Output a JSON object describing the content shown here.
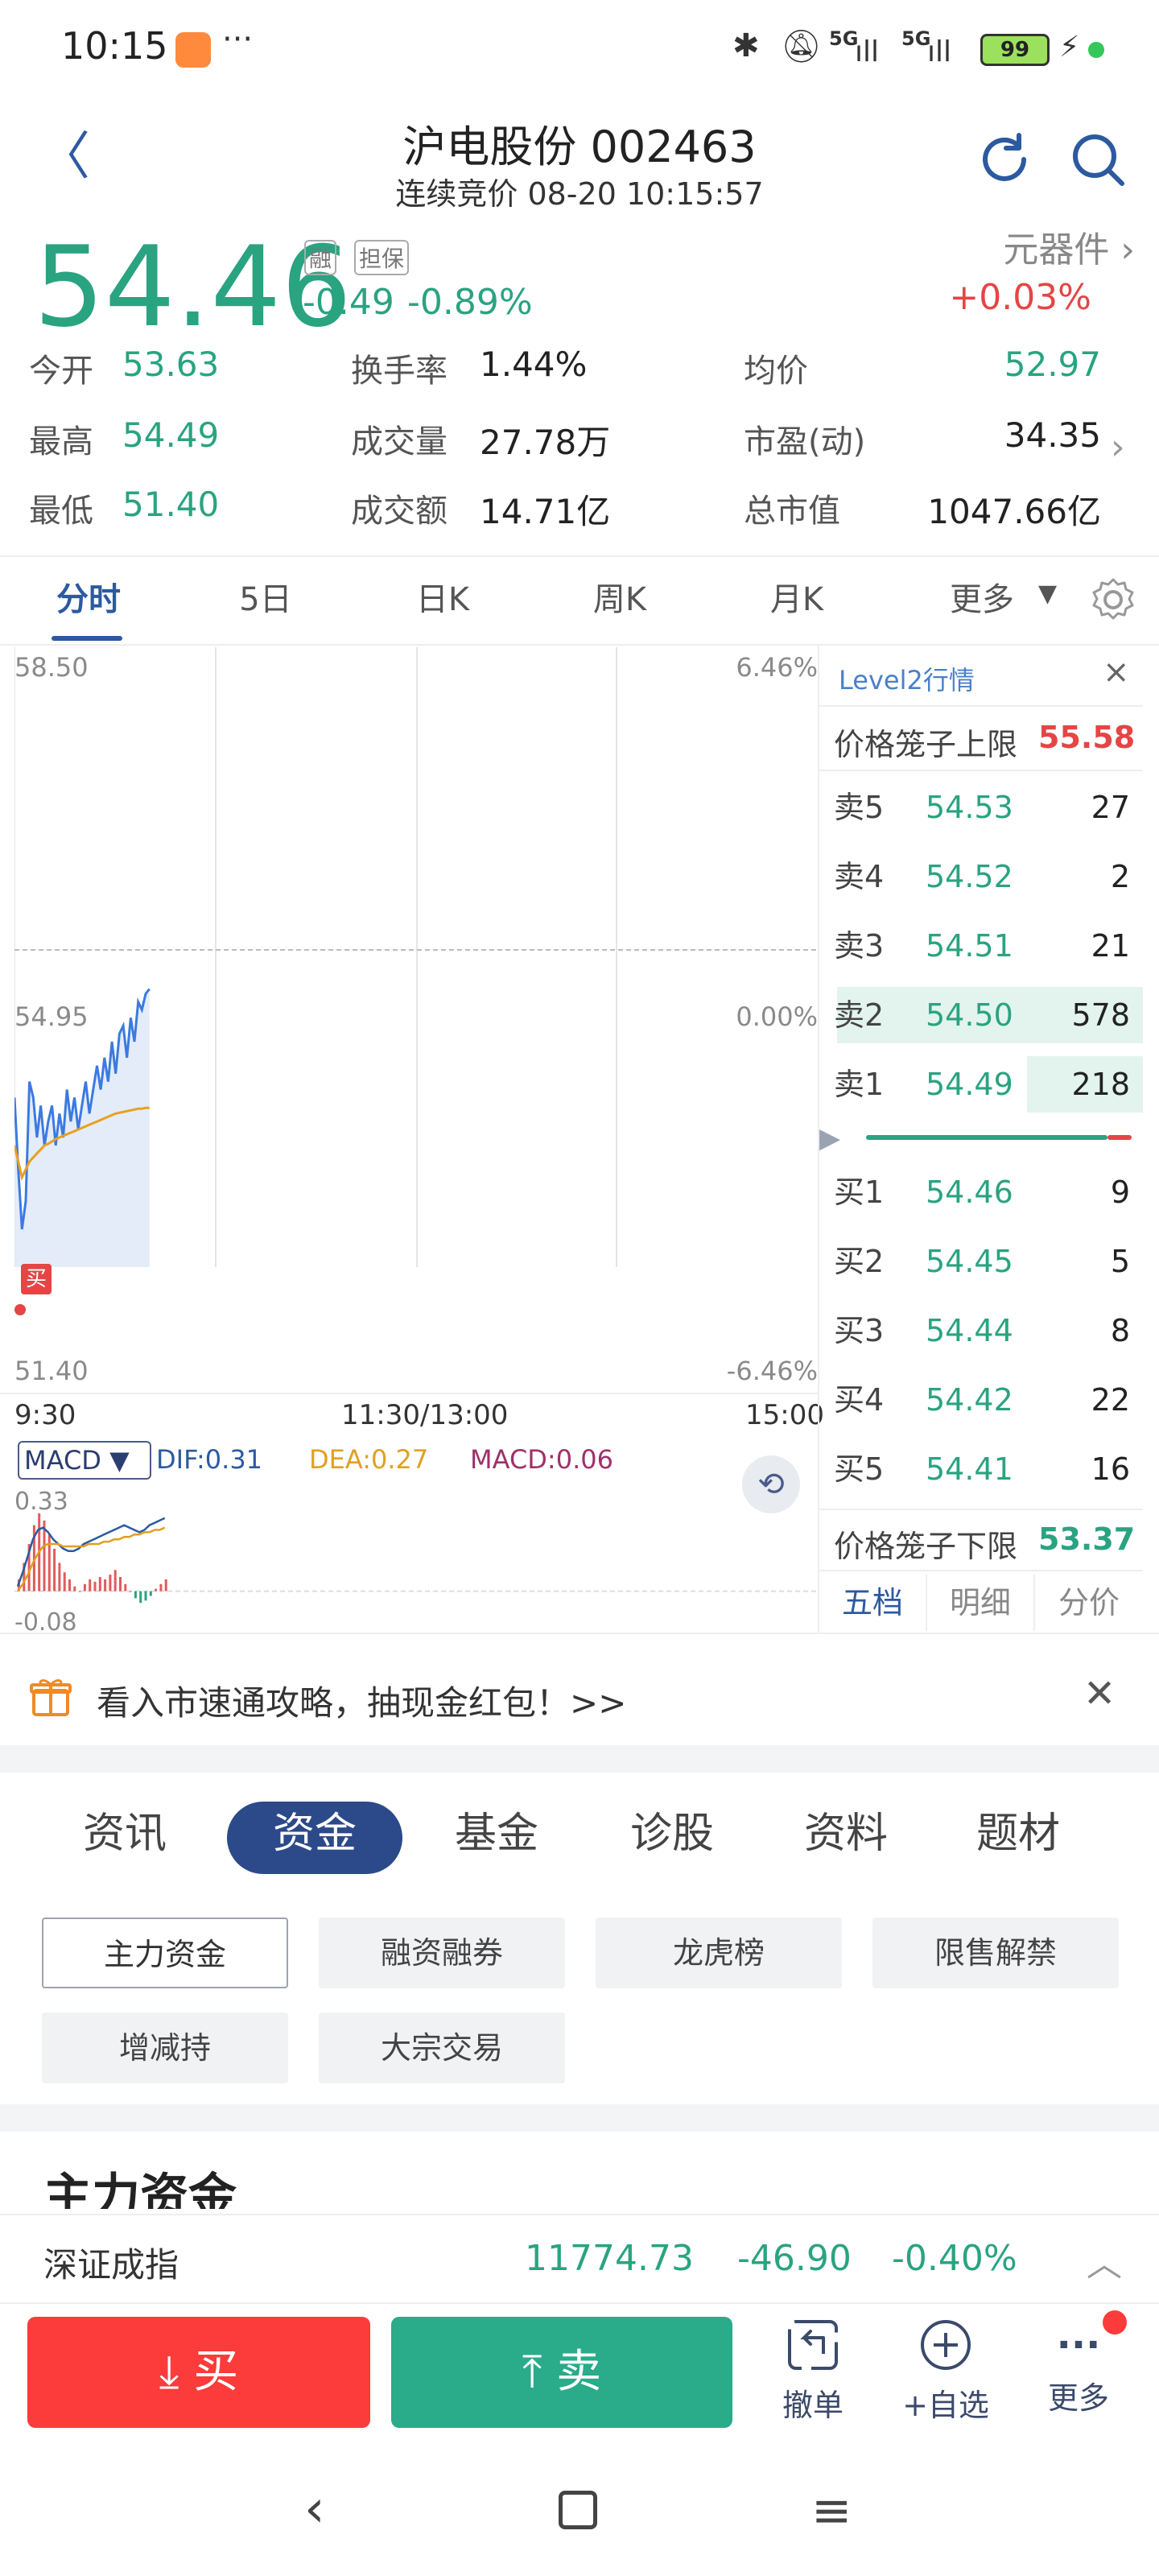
{
  "status_bar": {
    "time": "10:15",
    "dots": "···",
    "signal1": "5G",
    "signal2": "5G",
    "battery": "99"
  },
  "header": {
    "stock_name": "沪电股份 002463",
    "subtitle": "连续竞价 08-20 10:15:57"
  },
  "quote": {
    "price": "54.46",
    "tag1": "融",
    "tag2": "担保",
    "change": "-0.49",
    "change_pct": "-0.89%",
    "sector": "元器件",
    "sector_pct": "+0.03%"
  },
  "stats": [
    {
      "label": "今开",
      "value": "53.63"
    },
    {
      "label": "换手率",
      "value": "1.44%"
    },
    {
      "label": "均价",
      "value": "52.97"
    },
    {
      "label": "最高",
      "value": "54.49"
    },
    {
      "label": "成交量",
      "value": "27.78万"
    },
    {
      "label": "市盈(动)",
      "value": "34.35"
    },
    {
      "label": "最低",
      "value": "51.40"
    },
    {
      "label": "成交额",
      "value": "14.71亿"
    },
    {
      "label": "总市值",
      "value": "1047.66亿"
    }
  ],
  "ktabs": [
    "分时",
    "5日",
    "日K",
    "周K",
    "月K",
    "更多"
  ],
  "chart": {
    "y_top": "58.50",
    "y_mid": "54.95",
    "y_bot": "51.40",
    "pct_top": "6.46%",
    "pct_mid": "0.00%",
    "pct_bot": "-6.46%",
    "t_start": "9:30",
    "t_mid": "11:30/13:00",
    "t_end": "15:00",
    "buy_marker": "买",
    "price_series": [
      53.1,
      52.2,
      51.45,
      51.8,
      53.3,
      53.1,
      52.6,
      53.0,
      52.5,
      52.8,
      53.0,
      52.5,
      52.9,
      52.6,
      53.2,
      52.8,
      53.1,
      52.7,
      53.0,
      53.3,
      52.9,
      53.2,
      53.5,
      53.2,
      53.6,
      53.3,
      53.8,
      53.4,
      53.9,
      54.0,
      53.6,
      54.1,
      53.8,
      54.3,
      54.2,
      54.4,
      54.46
    ],
    "avg_series": [
      52.5,
      52.3,
      52.1,
      52.2,
      52.3,
      52.35,
      52.4,
      52.45,
      52.5,
      52.52,
      52.55,
      52.58,
      52.6,
      52.62,
      52.64,
      52.66,
      52.68,
      52.7,
      52.72,
      52.74,
      52.76,
      52.78,
      52.8,
      52.82,
      52.84,
      52.86,
      52.88,
      52.9,
      52.91,
      52.92,
      52.93,
      52.94,
      52.95,
      52.96,
      52.96,
      52.97,
      52.97
    ]
  },
  "macd": {
    "selector": "MACD ▼",
    "dif": "DIF:0.31",
    "dea": "DEA:0.27",
    "macd": "MACD:0.06",
    "y_top": "0.33",
    "y_bot": "-0.08",
    "bars": [
      0.05,
      0.12,
      0.2,
      0.28,
      0.33,
      0.3,
      0.24,
      0.18,
      0.12,
      0.08,
      0.05,
      0.02,
      0.0,
      0.03,
      0.05,
      0.04,
      0.06,
      0.05,
      0.07,
      0.09,
      0.06,
      0.03,
      0.0,
      -0.03,
      -0.05,
      -0.04,
      -0.02,
      0.01,
      0.03,
      0.05
    ],
    "dif_series": [
      0.02,
      0.08,
      0.15,
      0.22,
      0.26,
      0.27,
      0.25,
      0.22,
      0.2,
      0.18,
      0.17,
      0.17,
      0.18,
      0.2,
      0.21,
      0.22,
      0.23,
      0.24,
      0.25,
      0.26,
      0.27,
      0.28,
      0.27,
      0.26,
      0.25,
      0.26,
      0.28,
      0.29,
      0.3,
      0.31
    ],
    "dea_series": [
      0.0,
      0.03,
      0.07,
      0.12,
      0.16,
      0.19,
      0.2,
      0.2,
      0.2,
      0.19,
      0.19,
      0.19,
      0.19,
      0.19,
      0.2,
      0.2,
      0.2,
      0.21,
      0.21,
      0.22,
      0.22,
      0.23,
      0.23,
      0.24,
      0.24,
      0.25,
      0.25,
      0.26,
      0.26,
      0.27
    ]
  },
  "level2": {
    "title": "Level2行情",
    "close": "×",
    "upper_label": "价格笼子上限",
    "upper_value": "55.58",
    "lower_label": "价格笼子下限",
    "lower_value": "53.37",
    "asks": [
      {
        "label": "卖5",
        "price": "54.53",
        "vol": "27",
        "depth": 0.0
      },
      {
        "label": "卖4",
        "price": "54.52",
        "vol": "2",
        "depth": 0.0
      },
      {
        "label": "卖3",
        "price": "54.51",
        "vol": "21",
        "depth": 0.0
      },
      {
        "label": "卖2",
        "price": "54.50",
        "vol": "578",
        "depth": 1.0
      },
      {
        "label": "卖1",
        "price": "54.49",
        "vol": "218",
        "depth": 0.38
      }
    ],
    "bids": [
      {
        "label": "买1",
        "price": "54.46",
        "vol": "9"
      },
      {
        "label": "买2",
        "price": "54.45",
        "vol": "5"
      },
      {
        "label": "买3",
        "price": "54.44",
        "vol": "8"
      },
      {
        "label": "买4",
        "price": "54.42",
        "vol": "22"
      },
      {
        "label": "买5",
        "price": "54.41",
        "vol": "16"
      }
    ],
    "tabs": [
      "五档",
      "明细",
      "分价"
    ]
  },
  "promo": {
    "text": "看入市速通攻略，抽现金红包！>>"
  },
  "sections": [
    "资讯",
    "资金",
    "基金",
    "诊股",
    "资料",
    "题材"
  ],
  "pills": [
    "主力资金",
    "融资融券",
    "龙虎榜",
    "限售解禁",
    "增减持",
    "大宗交易"
  ],
  "section_heading": "主力资金",
  "index_bar": {
    "name": "深证成指",
    "value": "11774.73",
    "change": "-46.90",
    "pct": "-0.40%"
  },
  "bottom": {
    "buy": "买",
    "sell": "卖",
    "cancel": "撤单",
    "watch": "+自选",
    "more": "更多"
  }
}
